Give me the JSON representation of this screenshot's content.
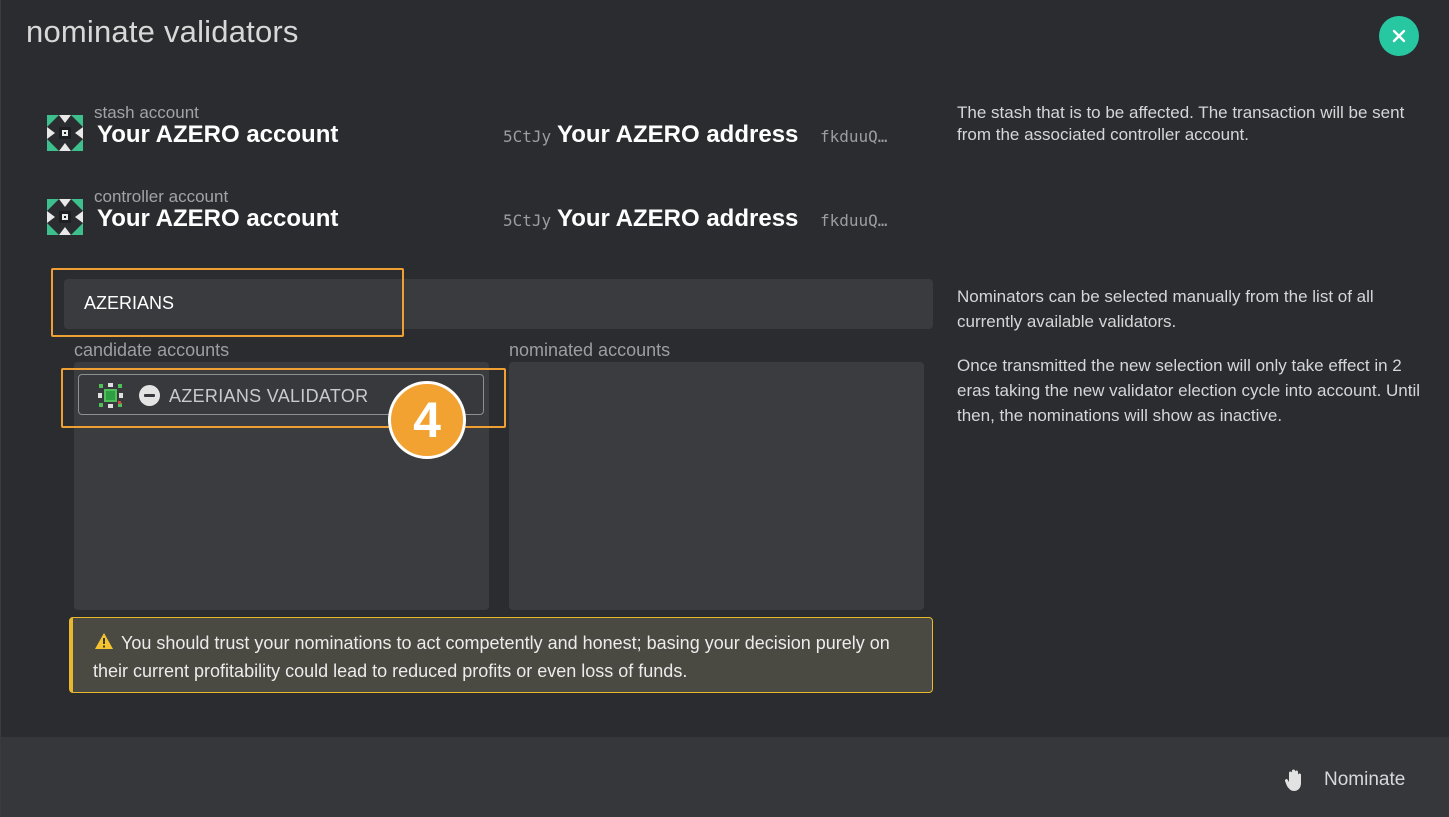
{
  "modal": {
    "title": "nominate validators"
  },
  "stash": {
    "label": "stash account",
    "name": "Your AZERO account",
    "address_prefix": "5CtJy",
    "address": "Your AZERO address",
    "address_suffix": "fkduuQ…"
  },
  "controller": {
    "label": "controller account",
    "name": "Your AZERO account",
    "address_prefix": "5CtJy",
    "address": "Your AZERO address",
    "address_suffix": "fkduuQ…"
  },
  "help": {
    "stash": "The stash that is to be affected. The transaction will be sent from the associated controller account.",
    "nominators_1": "Nominators can be selected manually from the list of all currently available validators.",
    "nominators_2": "Once transmitted the new selection will only take effect in 2 eras taking the new validator election cycle into account. Until then, the nominations will show as inactive."
  },
  "filter": {
    "value": "AZERIANS"
  },
  "lists": {
    "candidate_label": "candidate accounts",
    "nominated_label": "nominated accounts",
    "candidates": [
      {
        "name": "AZERIANS VALIDATOR"
      }
    ]
  },
  "step_badge": "4",
  "warning": {
    "text": "You should trust your nominations to act competently and honest; basing your decision purely on their current profitability could lead to reduced profits or even loss of funds."
  },
  "footer": {
    "nominate_label": "Nominate"
  },
  "colors": {
    "accent": "#27c7a2",
    "highlight": "#f0a033",
    "warning": "#e8b82e",
    "background": "#2b2c2f"
  },
  "icons": [
    "close-icon",
    "identicon",
    "minus-icon",
    "warning-icon",
    "hand-icon"
  ]
}
